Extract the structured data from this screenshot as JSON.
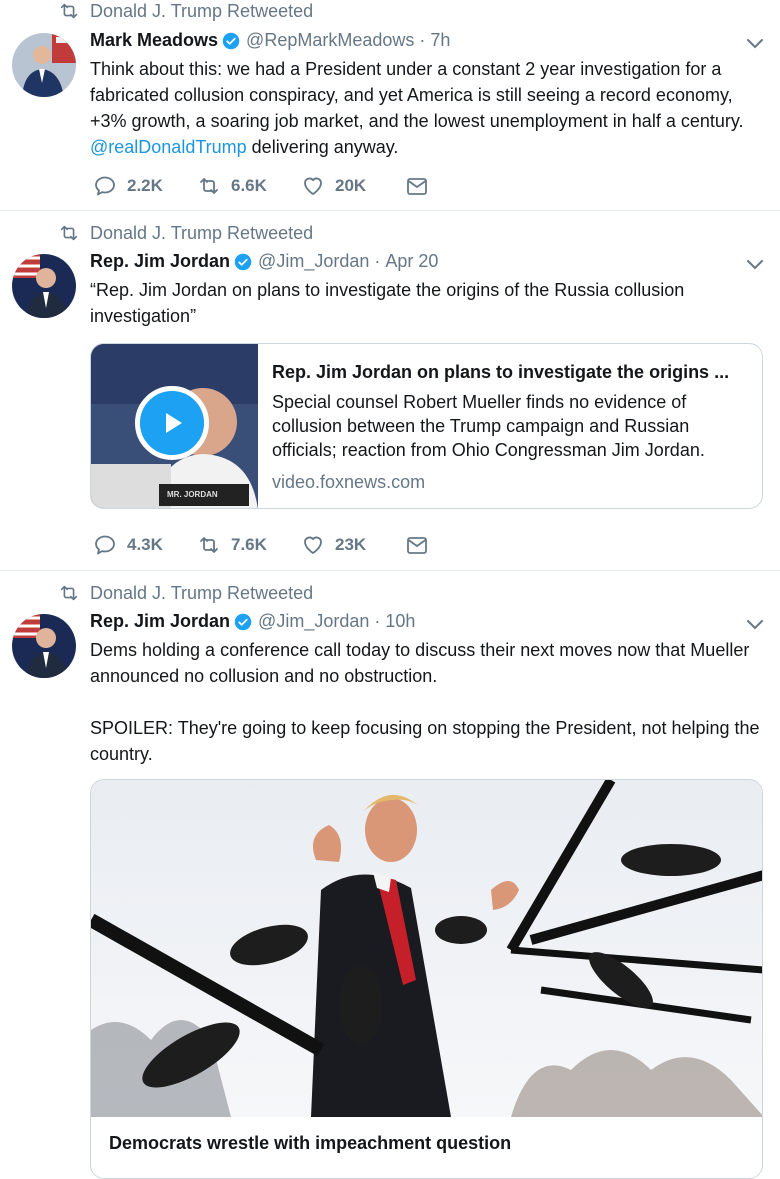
{
  "tweets": [
    {
      "retweeted_by": "Donald J. Trump Retweeted",
      "name": "Mark Meadows",
      "handle": "@RepMarkMeadows",
      "time": "7h",
      "text_before": "Think about this: we had a President under a constant 2 year investigation for a fabricated collusion conspiracy, and yet America is still seeing a record economy, +3% growth, a soaring job market, and the lowest unemployment in half a century. ",
      "mention": "@realDonaldTrump",
      "text_after": " delivering anyway.",
      "replies": "2.2K",
      "retweets": "6.6K",
      "likes": "20K"
    },
    {
      "retweeted_by": "Donald J. Trump Retweeted",
      "name": "Rep. Jim Jordan",
      "handle": "@Jim_Jordan",
      "time": "Apr 20",
      "text": "“Rep. Jim Jordan on plans to investigate the origins of the Russia collusion investigation”",
      "card": {
        "title": "Rep. Jim Jordan on plans to investigate the origins ...",
        "description": "Special counsel Robert Mueller finds no evidence of collusion between the Trump campaign and Russian officials; reaction from Ohio Congressman Jim Jordan.",
        "domain": "video.foxnews.com",
        "nameplate": "MR. JORDAN"
      },
      "replies": "4.3K",
      "retweets": "7.6K",
      "likes": "23K"
    },
    {
      "retweeted_by": "Donald J. Trump Retweeted",
      "name": "Rep. Jim Jordan",
      "handle": "@Jim_Jordan",
      "time": "10h",
      "text_p1": "Dems holding a conference call today to discuss their next moves now that Mueller announced no collusion and no obstruction.",
      "text_p2": "SPOILER: They're going to keep focusing on stopping the President, not helping the country.",
      "card_title": "Democrats wrestle with impeachment question"
    }
  ],
  "colors": {
    "verified": "#1da1f2",
    "link": "#1b95e0",
    "muted": "#657786",
    "border": "#e6ecf0"
  },
  "icons": [
    "retweet-icon",
    "verified-icon",
    "chevron-down-icon",
    "reply-icon",
    "like-icon",
    "dm-icon",
    "play-icon"
  ]
}
